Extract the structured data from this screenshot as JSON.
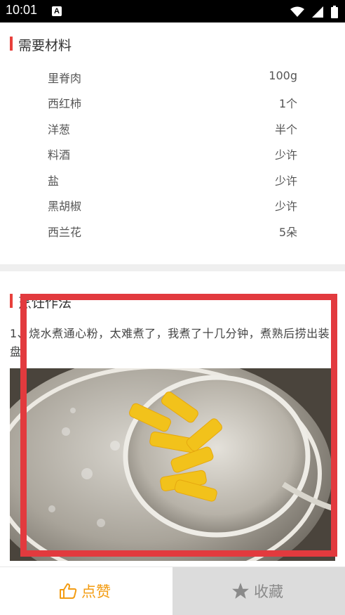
{
  "status_bar": {
    "time": "10:01",
    "notification_icon_letter": "A",
    "icons": [
      "wifi-icon",
      "signal-icon",
      "battery-icon"
    ]
  },
  "ingredients_section": {
    "title": "需要材料",
    "items": [
      {
        "name": "里脊肉",
        "amount": "100g"
      },
      {
        "name": "西红柿",
        "amount": "1个"
      },
      {
        "name": "洋葱",
        "amount": "半个"
      },
      {
        "name": "料酒",
        "amount": "少许"
      },
      {
        "name": "盐",
        "amount": "少许"
      },
      {
        "name": "黑胡椒",
        "amount": "少许"
      },
      {
        "name": "西兰花",
        "amount": "5朵"
      }
    ]
  },
  "steps_section": {
    "title": "烹饪作法",
    "step1_text": "1、烧水煮通心粉，太难煮了，我煮了十几分钟，煮熟后捞出装盘。"
  },
  "bottom_bar": {
    "like_label": "点赞",
    "favorite_label": "收藏"
  },
  "colors": {
    "accent_red": "#e8413c",
    "like_orange": "#f39c12",
    "overlay_red": "#e23a3e"
  }
}
